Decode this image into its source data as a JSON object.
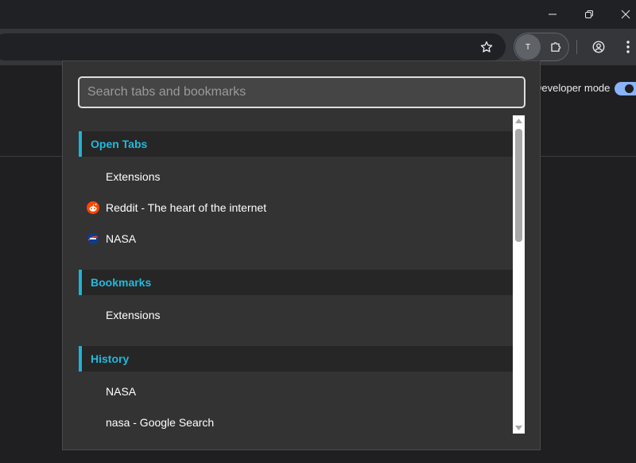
{
  "window": {
    "minimize_icon": "minimize-icon",
    "restore_icon": "restore-icon",
    "close_icon": "close-icon"
  },
  "toolbar": {
    "account_initial": "T",
    "icons": [
      "star-icon",
      "extensions-puzzle-icon",
      "profile-icon",
      "menu-kebab-icon"
    ]
  },
  "page": {
    "dev_mode_label": "Developer mode",
    "dev_mode_on": true
  },
  "popup": {
    "search": {
      "placeholder": "Search tabs and bookmarks",
      "value": ""
    },
    "sections": [
      {
        "title": "Open Tabs",
        "items": [
          {
            "label": "Extensions",
            "icon": "none"
          },
          {
            "label": "Reddit - The heart of the internet",
            "icon": "reddit-icon"
          },
          {
            "label": "NASA",
            "icon": "nasa-icon"
          }
        ]
      },
      {
        "title": "Bookmarks",
        "items": [
          {
            "label": "Extensions",
            "icon": "none"
          }
        ]
      },
      {
        "title": "History",
        "items": [
          {
            "label": "NASA",
            "icon": "none"
          },
          {
            "label": "nasa - Google Search",
            "icon": "none"
          }
        ]
      }
    ]
  },
  "colors": {
    "accent": "#22b9dc",
    "popup_bg": "#333333",
    "section_bg": "#262626"
  }
}
